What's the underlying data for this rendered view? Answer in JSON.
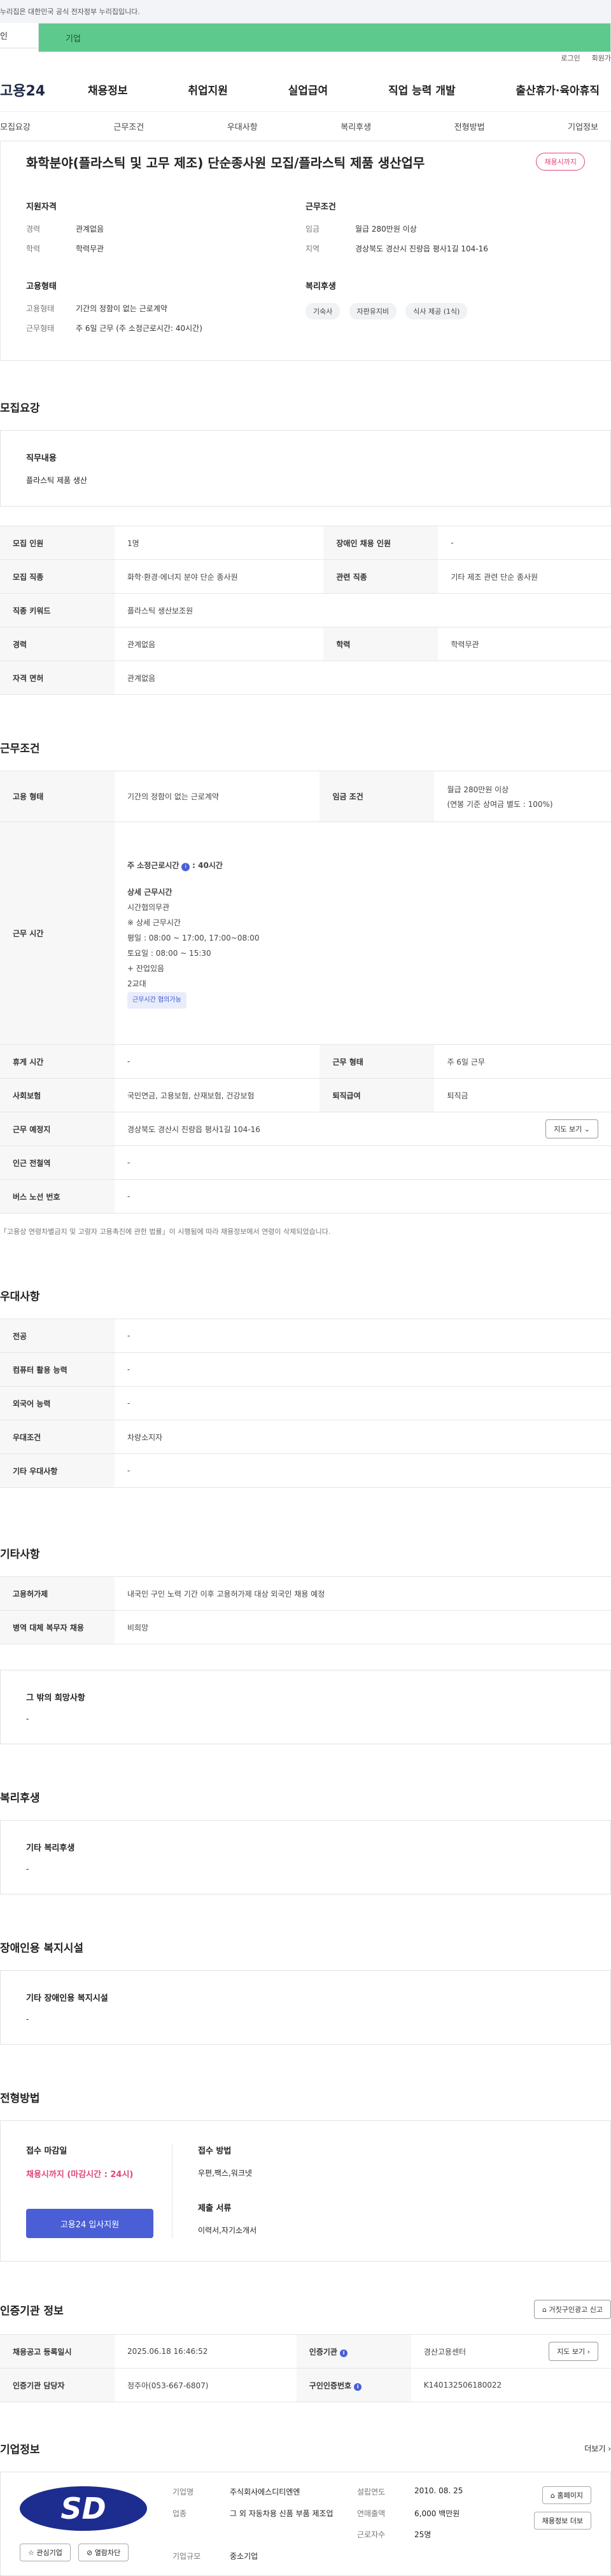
{
  "gov_notice": "누리집은 대한민국 공식 전자정부 누리집입니다.",
  "top_tabs": [
    "인",
    "기업"
  ],
  "util": [
    "로그인",
    "회원가"
  ],
  "logo": "고용24",
  "gnb": [
    "채용정보",
    "취업지원",
    "실업급여",
    "직업 능력 개발",
    "출산휴가·육아휴직"
  ],
  "subtabs": [
    "모집요강",
    "근무조건",
    "우대사항",
    "복리후생",
    "전형방법",
    "기업정보"
  ],
  "summary": {
    "title": "화학분야(플라스틱 및 고무 제조) 단순종사원 모집/플라스틱 제품 생산업무",
    "badge": "채용시까지",
    "qualification_title": "지원자격",
    "career_k": "경력",
    "career_v": "관계없음",
    "edu_k": "학력",
    "edu_v": "학력무관",
    "employment_title": "고용형태",
    "emp_k": "고용형태",
    "emp_v": "기간의 정함이 없는 근로계약",
    "work_k": "근무형태",
    "work_v": "주 6일 근무 (주 소정근로시간: 40시간)",
    "condition_title": "근무조건",
    "wage_k": "임금",
    "wage_v": "월급 280만원 이상",
    "region_k": "지역",
    "region_v": "경상북도 경산시 진량읍 평사1길 104-16",
    "welfare_title": "복리후생",
    "welfare_chips": [
      "기숙사",
      "자판유지비",
      "식사 제공 (1식)"
    ]
  },
  "recruit": {
    "title": "모집요강",
    "job_box_title": "직무내용",
    "job_box_text": "플라스틱 제품 생산",
    "rows": {
      "count_k": "모집 인원",
      "count_v": "1명",
      "disabled_k": "장애인 채용 인원",
      "disabled_v": "-",
      "job_k": "모집 직종",
      "job_v": "화학·환경·에너지 분야 단순 종사원",
      "related_k": "관련 직종",
      "related_v": "기타 제조 관련 단순 종사원",
      "keyword_k": "직종 키워드",
      "keyword_v": "플라스틱 생산보조원",
      "career_k": "경력",
      "career_v": "관계없음",
      "edu_k": "학력",
      "edu_v": "학력무관",
      "license_k": "자격 면허",
      "license_v": "관계없음"
    }
  },
  "work": {
    "title": "근무조건",
    "emp_k": "고용 형태",
    "emp_v": "기간의 정함이 없는 근로계약",
    "wage_k": "임금 조건",
    "wage_v1": "월급 280만원 이상",
    "wage_v2": "(연봉 기준 상여금 별도 : 100%)",
    "hours_k": "근무 시간",
    "hours_l1": "주 소정근로시간",
    "hours_l1b": ": 40시간",
    "hours_l2": "상세 근무시간",
    "hours_l3": "시간협의무관",
    "hours_l4": "※ 상세 근무시간",
    "hours_l5": "평일 : 08:00 ~ 17:00, 17:00~08:00",
    "hours_l6": "토요일 : 08:00 ~ 15:30",
    "hours_l7": "+ 잔업있음",
    "hours_l8": "2교대",
    "hours_chip": "근무시간 협의가능",
    "break_k": "휴게 시간",
    "break_v": "-",
    "form_k": "근무 형태",
    "form_v": "주 6일 근무",
    "insurance_k": "사회보험",
    "insurance_v": "국민연금, 고용보험, 산재보험, 건강보험",
    "severance_k": "퇴직급여",
    "severance_v": "퇴직금",
    "place_k": "근무 예정지",
    "place_v": "경상북도 경산시 진량읍 평사1길 104-16",
    "map_btn": "지도 보기",
    "subway_k": "인근 전철역",
    "subway_v": "-",
    "bus_k": "버스 노선 번호",
    "bus_v": "-",
    "note": "「고용상 연령차별금지 및 고령자 고용촉진에 관한 법률」이 시행됨에 따라 채용정보에서 연령이 삭제되었습니다."
  },
  "prefer": {
    "title": "우대사항",
    "major_k": "전공",
    "major_v": "-",
    "computer_k": "컴퓨터 활용 능력",
    "computer_v": "-",
    "language_k": "외국어 능력",
    "language_v": "-",
    "cond_k": "우대조건",
    "cond_v": "차량소지자",
    "etc_k": "기타 우대사항",
    "etc_v": "-"
  },
  "etc": {
    "title": "기타사항",
    "permit_k": "고용허가제",
    "permit_v": "내국인 구인 노력 기간 이후 고용허가제 대상 외국인 채용 예정",
    "military_k": "병역 대체 복무자 채용",
    "military_v": "비희망",
    "box_title": "그 밖의 희망사항",
    "box_text": "-"
  },
  "welfare": {
    "title": "복리후생",
    "box_title": "기타 복리후생",
    "box_text": "-"
  },
  "disabled_fac": {
    "title": "장애인용 복지시설",
    "box_title": "기타 장애인용 복지시설",
    "box_text": "-"
  },
  "selection": {
    "title": "전형방법",
    "deadline_label": "접수 마감일",
    "deadline_value": "채용시까지 (마감시간 : 24시)",
    "apply_button": "고용24 입사지원",
    "method_label": "접수 방법",
    "method_value": "우편,팩스,워크넷",
    "docs_label": "제출 서류",
    "docs_value": "이력서,자기소개서"
  },
  "agency": {
    "title": "인증기관 정보",
    "report_btn": "거짓구인광고 신고",
    "reg_k": "채용공고 등록일시",
    "reg_v": "2025.06.18 16:46:52",
    "org_k": "인증기관",
    "org_v": "경산고용센터",
    "map_btn": "지도 보기",
    "manager_k": "인증기관 담당자",
    "manager_v": "정주아(053-667-6807)",
    "cert_k": "구인인증번호",
    "cert_v": "K140132506180022"
  },
  "company": {
    "title": "기업정보",
    "more": "더보기",
    "logo_text": "SD",
    "fav_btn": "관심기업",
    "follow_btn": "열람차단",
    "name_k": "기업명",
    "name_v": "주식회사에스디티엔엔",
    "founded_k": "설립연도",
    "founded_v": "2010. 08. 25",
    "industry_k": "업종",
    "industry_v": "그 외 자동차용 신품 부품 제조업",
    "sales_k": "연매출액",
    "sales_v": "6,000 백만원",
    "workers_k": "근로자수",
    "workers_v": "25명",
    "size_k": "기업규모",
    "size_v": "중소기업",
    "homepage_btn": "홈페이지",
    "recruit_btn": "채용정보 더보"
  }
}
